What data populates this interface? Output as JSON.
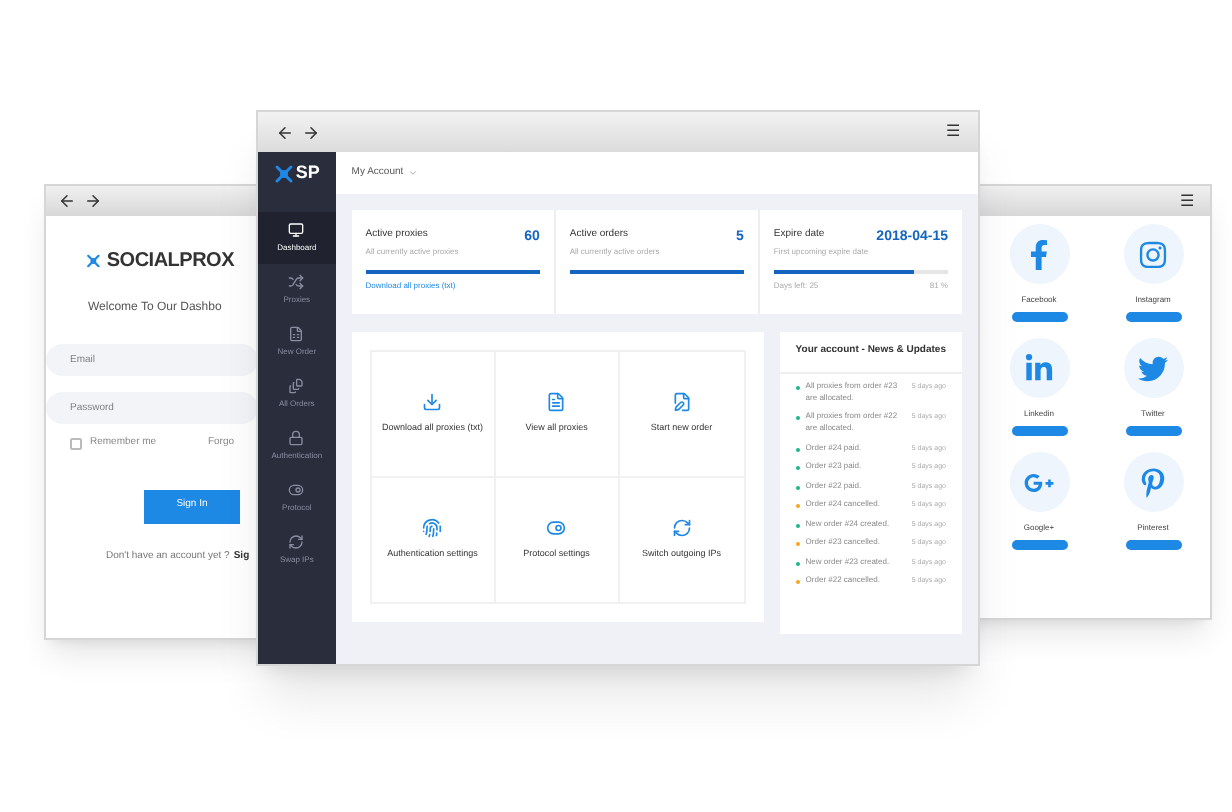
{
  "login_window": {
    "logo": "SOCIALPROX",
    "welcome": "Welcome To Our Dashbo",
    "email": {
      "placeholder": "Email"
    },
    "password": {
      "placeholder": "Password"
    },
    "remember": {
      "label": "Remember me",
      "checked": false
    },
    "forgot": "Forgo",
    "sign_in": "Sign In",
    "signup_prompt": "Don't have an account yet ?",
    "signup_link": "Sig"
  },
  "dashboard_window": {
    "logo": "SP",
    "menu_glyph": "☰",
    "sidebar": [
      {
        "label": "Dashboard",
        "selected": true
      },
      {
        "label": "Proxies",
        "selected": false
      },
      {
        "label": "New Order",
        "selected": false
      },
      {
        "label": "All Orders",
        "selected": false
      },
      {
        "label": "Authentication",
        "selected": false
      },
      {
        "label": "Protocol",
        "selected": false
      },
      {
        "label": "Swap IPs",
        "selected": false
      }
    ],
    "header": "My Account",
    "stats": [
      {
        "title": "Active proxies",
        "subtitle": "All currently active proxies",
        "value": "60",
        "level": 1,
        "link": "Download all proxies (txt)"
      },
      {
        "title": "Active orders",
        "subtitle": "All currently active orders",
        "value": "5",
        "level": 1
      },
      {
        "title": "Expire date",
        "subtitle": "First upcoming expire date",
        "value": "2018-04-15",
        "level": 0.81,
        "note": "Days left: 25",
        "percent": "81 %"
      }
    ],
    "actions": [
      {
        "label": "Download all proxies (txt)"
      },
      {
        "label": "View all proxies"
      },
      {
        "label": "Start new order"
      },
      {
        "label": "Authentication settings"
      },
      {
        "label": "Protocol settings"
      },
      {
        "label": "Switch outgoing IPs"
      }
    ],
    "news": {
      "title": "Your account - News & Updates",
      "items": [
        {
          "text": "All proxies from order #23 are allocated.",
          "time": "5 days ago",
          "color": "#1cb58a"
        },
        {
          "text": "All proxies from order #22 are allocated.",
          "time": "5 days ago",
          "color": "#1cb58a"
        },
        {
          "text": "Order #24 paid.",
          "time": "5 days ago",
          "color": "#1cb58a"
        },
        {
          "text": "Order #23 paid.",
          "time": "5 days ago",
          "color": "#1cb58a"
        },
        {
          "text": "Order #22 paid.",
          "time": "5 days ago",
          "color": "#1cb58a"
        },
        {
          "text": "Order #24 cancelled.",
          "time": "5 days ago",
          "color": "#f5a623"
        },
        {
          "text": "New order #24 created.",
          "time": "5 days ago",
          "color": "#1cb58a"
        },
        {
          "text": "Order #23 cancelled.",
          "time": "5 days ago",
          "color": "#f5a623"
        },
        {
          "text": "New order #23 created.",
          "time": "5 days ago",
          "color": "#1cb58a"
        },
        {
          "text": "Order #22 cancelled.",
          "time": "5 days ago",
          "color": "#f5a623"
        }
      ]
    }
  },
  "social_window": {
    "menu_glyph": "☰",
    "items": [
      {
        "label": "Facebook"
      },
      {
        "label": "Instagram"
      },
      {
        "label": "Linkedin"
      },
      {
        "label": "Twitter"
      },
      {
        "label": "Google+"
      },
      {
        "label": "Pinterest"
      }
    ]
  }
}
